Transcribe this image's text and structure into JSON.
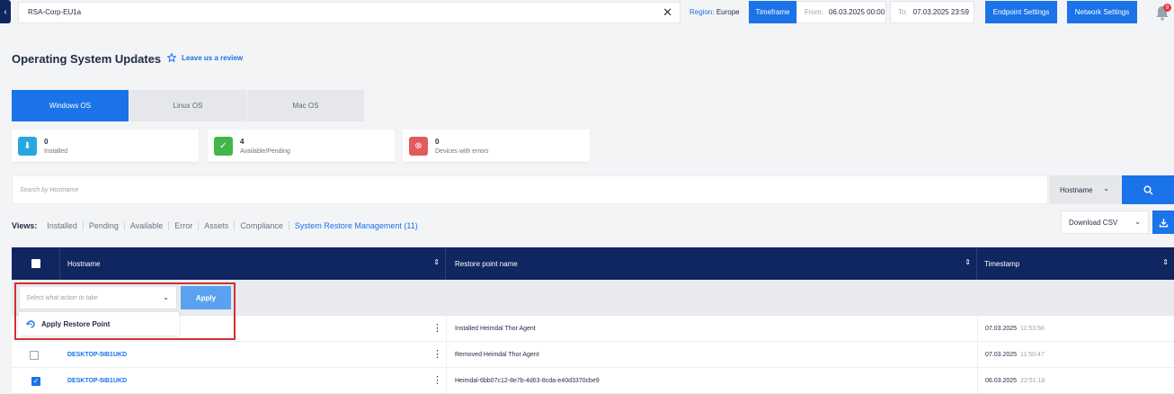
{
  "topbar": {
    "tenant": "RSA-Corp-EU1a",
    "region_label": "Region:",
    "region_value": "Europe",
    "timeframe_label": "Timeframe",
    "from_label": "From:",
    "from_value": "06.03.2025 00:00",
    "to_label": "To:",
    "to_value": "07.03.2025 23:59",
    "endpoint_settings": "Endpoint Settings",
    "network_settings": "Network Settings",
    "notification_count": "9"
  },
  "page": {
    "title": "Operating System Updates",
    "review_link": "Leave us a review"
  },
  "tabs": [
    {
      "label": "Windows OS"
    },
    {
      "label": "Linux OS"
    },
    {
      "label": "Mac OS"
    }
  ],
  "cards": [
    {
      "count": "0",
      "label": "Installed",
      "color": "#26a7de"
    },
    {
      "count": "4",
      "label": "Available/Pending",
      "color": "#43b649"
    },
    {
      "count": "0",
      "label": "Devices with errors",
      "color": "#e35b5b"
    }
  ],
  "search": {
    "placeholder": "Search by Hostname",
    "field": "Hostname"
  },
  "views": {
    "label": "Views:",
    "items": [
      "Installed",
      "Pending",
      "Available",
      "Error",
      "Assets",
      "Compliance",
      "System Restore Management (11)"
    ]
  },
  "export": {
    "label": "Download CSV"
  },
  "table": {
    "columns": [
      "Hostname",
      "Restore point name",
      "Timestamp"
    ],
    "rows": [
      {
        "hostname": "",
        "restore_point": "Installed Heimdal Thor Agent",
        "date": "07.03.2025",
        "time": "11:53:56",
        "checked": false
      },
      {
        "hostname": "DESKTOP-5IB1UKD",
        "restore_point": "Removed Heimdal Thor Agent",
        "date": "07.03.2025",
        "time": "11:50:47",
        "checked": false
      },
      {
        "hostname": "DESKTOP-5IB1UKD",
        "restore_point": "Heimdal-6bb07c12-8e7b-4d63-8cda-e40d3370cbe9",
        "date": "06.03.2025",
        "time": "22:51:18",
        "checked": true
      }
    ]
  },
  "action": {
    "placeholder": "Select what action to take",
    "apply": "Apply",
    "option": "Apply Restore Point"
  },
  "colors": {
    "accent": "#1a73e8",
    "header_navy": "#102660",
    "highlight_red": "#d32f2f"
  }
}
